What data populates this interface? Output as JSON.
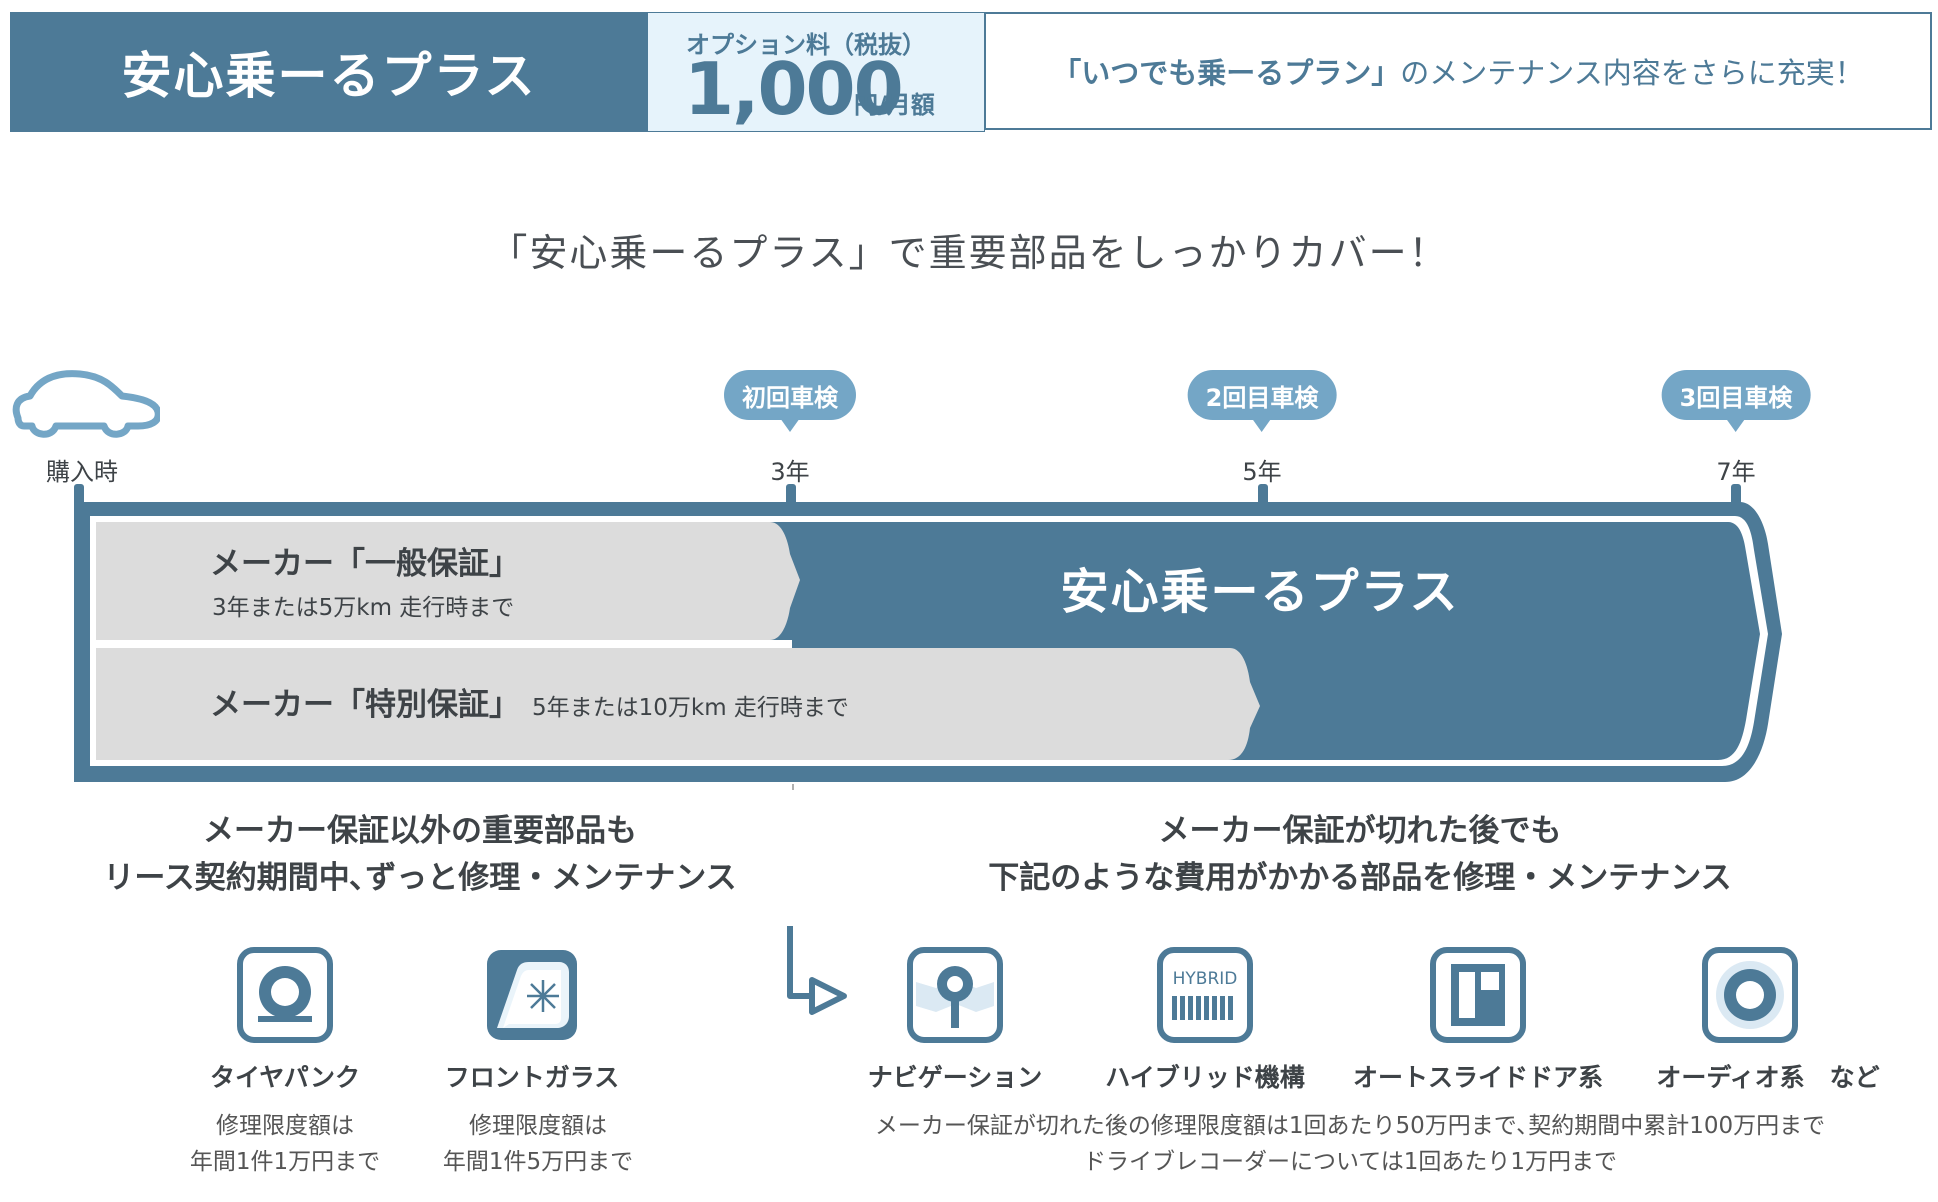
{
  "header": {
    "title": "安心乗ーるプラス",
    "price_label": "オプション料（税抜）",
    "price_value": "1,000",
    "price_unit": "円/月額",
    "message_quote": "「いつでも乗ーるプラン」",
    "message_rest": "のメンテナンス内容をさらに充実！"
  },
  "headline": "「安心乗ーるプラス」で重要部品をしっかりカバー！",
  "timeline": {
    "start_label": "購入時",
    "points": [
      {
        "badge": "初回車検",
        "label": "3年"
      },
      {
        "badge": "2回目車検",
        "label": "5年"
      },
      {
        "badge": "3回目車検",
        "label": "7年"
      }
    ],
    "general_warranty_title": "メーカー「一般保証」",
    "general_warranty_note": "3年または5万km 走行時まで",
    "special_warranty_title": "メーカー「特別保証」",
    "special_warranty_note": "5年または10万km 走行時まで",
    "plus_label": "安心乗ーるプラス"
  },
  "left_section": {
    "line1": "メーカー保証以外の重要部品も",
    "line2": "リース契約期間中､ずっと修理・メンテナンス",
    "items": [
      {
        "icon": "tire-icon",
        "name": "タイヤパンク",
        "note1": "修理限度額は",
        "note2": "年間1件1万円まで"
      },
      {
        "icon": "windshield-icon",
        "name": "フロントガラス",
        "note1": "修理限度額は",
        "note2": "年間1件5万円まで"
      }
    ]
  },
  "right_section": {
    "line1": "メーカー保証が切れた後でも",
    "line2": "下記のような費用がかかる部品を修理・メンテナンス",
    "items": [
      {
        "icon": "navigation-icon",
        "name": "ナビゲーション"
      },
      {
        "icon": "hybrid-icon",
        "name": "ハイブリッド機構",
        "icon_text": "HYBRID"
      },
      {
        "icon": "slide-door-icon",
        "name": "オートスライドドア系"
      },
      {
        "icon": "audio-icon",
        "name": "オーディオ系　など"
      }
    ],
    "note1": "メーカー保証が切れた後の修理限度額は1回あたり50万円まで､契約期間中累計100万円まで",
    "note2": "ドライブレコーダーについては1回あたり1万円まで"
  },
  "colors": {
    "primary": "#4d7a97",
    "badge": "#74a6c6",
    "light_bg": "#e6f3fb",
    "warranty_gray": "#dcdcdc"
  }
}
